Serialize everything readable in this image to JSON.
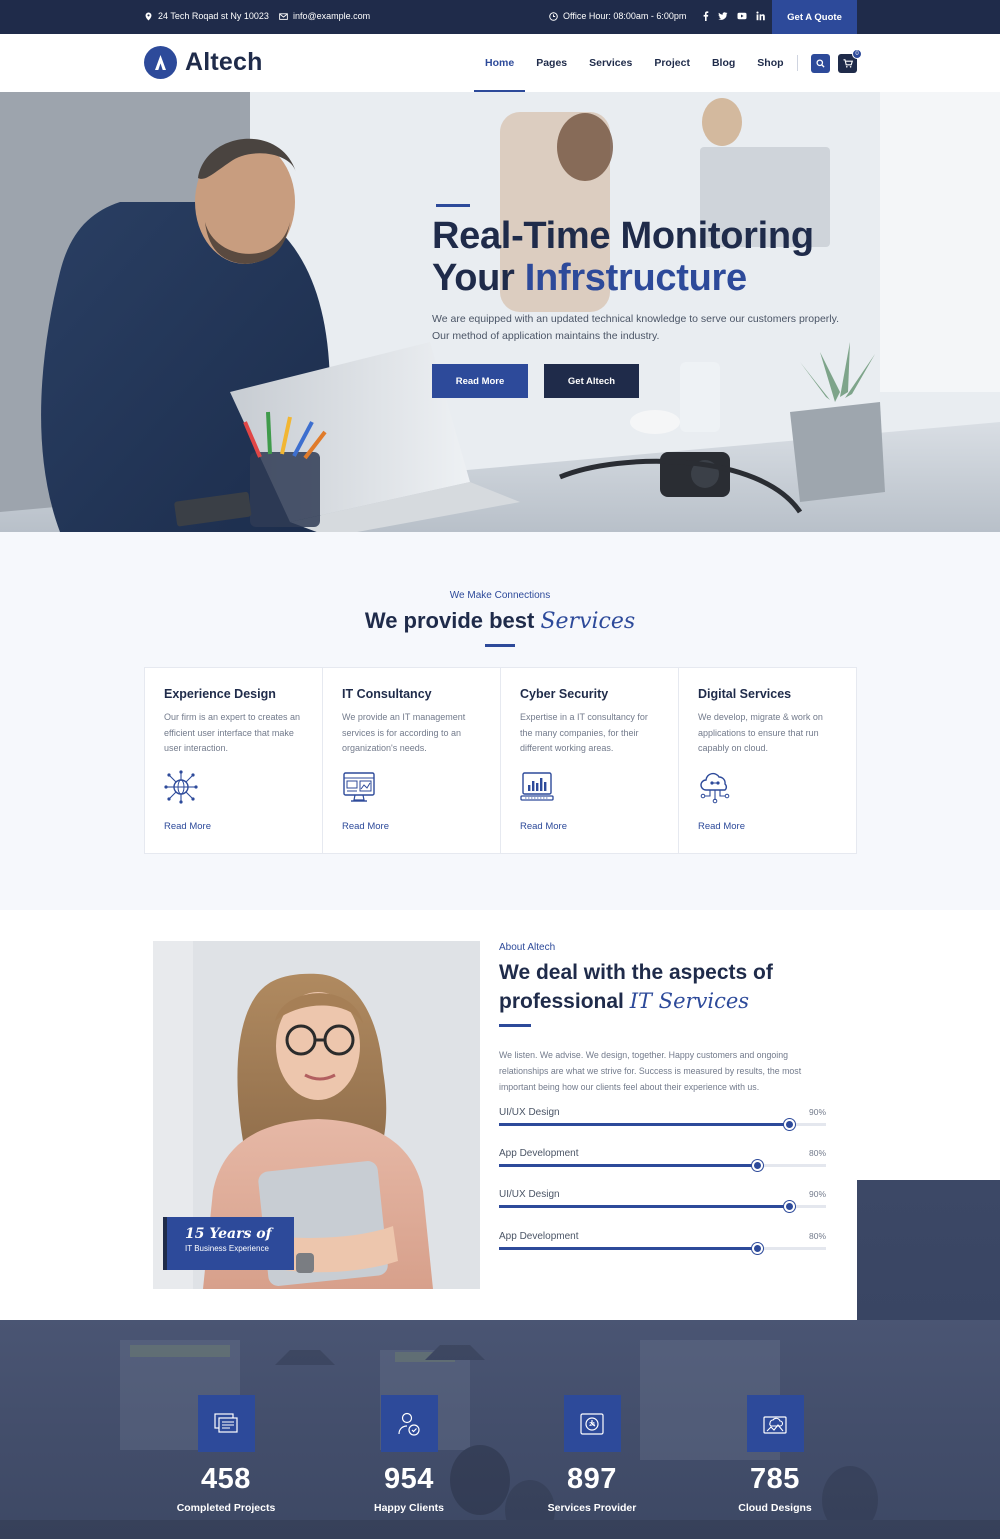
{
  "topbar": {
    "address": "24 Tech Roqad st Ny 10023",
    "email": "info@example.com",
    "hours": "Office Hour: 08:00am - 6:00pm",
    "socials": [
      "f",
      "t",
      "yt",
      "in"
    ],
    "quote_label": "Get A Quote"
  },
  "header": {
    "brand": "Altech",
    "nav": [
      "Home",
      "Pages",
      "Services",
      "Project",
      "Blog",
      "Shop"
    ],
    "active_nav": "Home",
    "cart_count": "0"
  },
  "hero": {
    "title_line1": "Real-Time Monitoring",
    "title_line2_prefix": "Your ",
    "title_line2_accent": "Infrstructure",
    "text": "We are equipped with an updated technical knowledge to serve our customers properly. Our method of application maintains the industry.",
    "btn_primary": "Read More",
    "btn_secondary": "Get Altech"
  },
  "services": {
    "kicker": "We Make Connections",
    "title_prefix": "We provide best ",
    "title_accent": "Services",
    "cards": [
      {
        "title": "Experience Design",
        "text": "Our firm is an expert to creates an efficient user interface that make user interaction.",
        "link": "Read More",
        "icon": "network-globe-icon"
      },
      {
        "title": "IT Consultancy",
        "text": "We provide an IT management services is for according to an organization's needs.",
        "link": "Read More",
        "icon": "monitor-dashboard-icon"
      },
      {
        "title": "Cyber Security",
        "text": "Expertise in a IT consultancy for the many companies, for their different working areas.",
        "link": "Read More",
        "icon": "computer-chart-icon"
      },
      {
        "title": "Digital Services",
        "text": "We develop, migrate & work on applications to ensure that run capably on cloud.",
        "link": "Read More",
        "icon": "cloud-network-icon"
      }
    ]
  },
  "about": {
    "badge_years": "15 Years of",
    "badge_sub": "IT Business Experience",
    "kicker": "About Altech",
    "title_line1": "We deal with the aspects of",
    "title_line2_prefix": "professional ",
    "title_line2_accent": "IT Services",
    "text": "We listen. We advise. We design, together. Happy customers and ongoing relationships are what we strive for. Success is measured by results, the most important being how our clients feel about their experience with us.",
    "skills": [
      {
        "label": "UI/UX Design",
        "pct_text": "90%",
        "value": 90
      },
      {
        "label": "App Development",
        "pct_text": "80%",
        "value": 80
      },
      {
        "label": "UI/UX Design",
        "pct_text": "90%",
        "value": 90
      },
      {
        "label": "App Development",
        "pct_text": "80%",
        "value": 80
      }
    ]
  },
  "stats": [
    {
      "number": "458",
      "label": "Completed Projects",
      "icon": "projects-icon"
    },
    {
      "number": "954",
      "label": "Happy Clients",
      "icon": "client-icon"
    },
    {
      "number": "897",
      "label": "Services Provider",
      "icon": "service-icon"
    },
    {
      "number": "785",
      "label": "Cloud Designs",
      "icon": "cloud-design-icon"
    }
  ],
  "colors": {
    "primary": "#2d4a9a",
    "dark": "#1f2b4a",
    "light_bg": "#f6f8fc"
  }
}
